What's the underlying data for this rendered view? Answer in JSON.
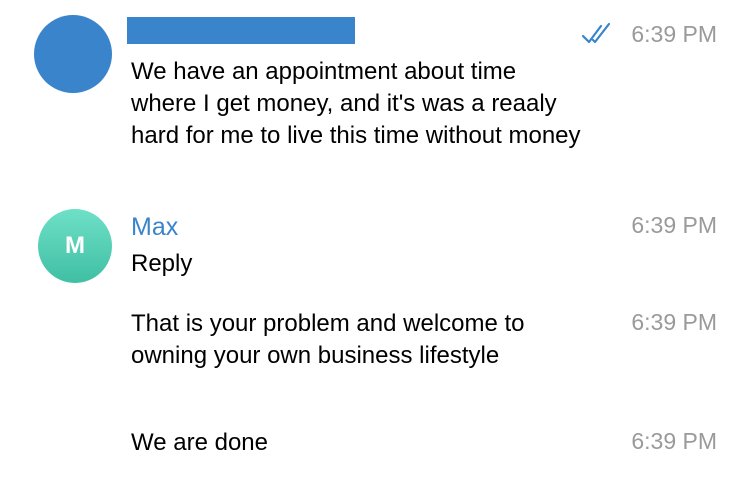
{
  "messages": [
    {
      "sender": "",
      "text": "We have an appointment about time where I get money, and it's was a reaaly hard for me to live this time without money",
      "time": "6:39 PM",
      "read_status": "double-check-icon"
    },
    {
      "sender": "Max",
      "avatar_initial": "M",
      "text": "Reply",
      "time": "6:39 PM"
    },
    {
      "text": "That is your problem and welcome to owning your own business lifestyle",
      "time": "6:39 PM"
    },
    {
      "text": "We are done",
      "time": "6:39 PM"
    }
  ],
  "colors": {
    "accent": "#3a84cb",
    "avatar_max": "#4fcfb2",
    "timestamp": "#9a9a9a"
  }
}
